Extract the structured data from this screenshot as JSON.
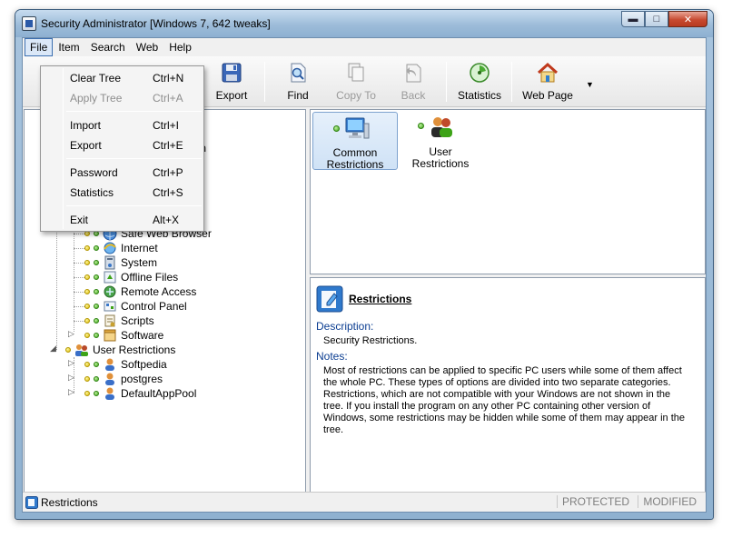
{
  "window": {
    "title": "Security Administrator [Windows 7, 642 tweaks]"
  },
  "caption": {
    "minimize": "▬",
    "maximize": "□",
    "close": "✕"
  },
  "menubar": {
    "file": "File",
    "item": "Item",
    "search": "Search",
    "web": "Web",
    "help": "Help"
  },
  "file_menu": {
    "clear_tree": {
      "label": "Clear Tree",
      "shortcut": "Ctrl+N"
    },
    "apply_tree": {
      "label": "Apply Tree",
      "shortcut": "Ctrl+A"
    },
    "import": {
      "label": "Import",
      "shortcut": "Ctrl+I"
    },
    "export": {
      "label": "Export",
      "shortcut": "Ctrl+E"
    },
    "password": {
      "label": "Password",
      "shortcut": "Ctrl+P"
    },
    "statistics": {
      "label": "Statistics",
      "shortcut": "Ctrl+S"
    },
    "exit": {
      "label": "Exit",
      "shortcut": "Alt+X"
    }
  },
  "toolbar": {
    "export": "Export",
    "find": "Find",
    "copy_to": "Copy To",
    "back": "Back",
    "statistics": "Statistics",
    "web_page": "Web Page",
    "dropdown_arrow": "▼"
  },
  "tree": {
    "partial_hidden_text": "own",
    "items": [
      {
        "label": "Safe Web Browser",
        "icon": "globe-icon"
      },
      {
        "label": "Internet",
        "icon": "ie-icon"
      },
      {
        "label": "System",
        "icon": "system-icon"
      },
      {
        "label": "Offline Files",
        "icon": "offline-files-icon"
      },
      {
        "label": "Remote Access",
        "icon": "remote-access-icon"
      },
      {
        "label": "Control Panel",
        "icon": "control-panel-icon"
      },
      {
        "label": "Scripts",
        "icon": "scripts-icon"
      },
      {
        "label": "Software",
        "icon": "software-icon"
      }
    ],
    "user_restrictions": "User Restrictions",
    "users": [
      {
        "label": "Softpedia"
      },
      {
        "label": "postgres"
      },
      {
        "label": "DefaultAppPool"
      }
    ]
  },
  "categories": {
    "common": "Common Restrictions",
    "common_line1": "Common",
    "common_line2": "Restrictions",
    "user_line1": "User",
    "user_line2": "Restrictions"
  },
  "detail": {
    "title": "Restrictions",
    "description_label": "Description:",
    "description": "Security Restrictions.",
    "notes_label": "Notes:",
    "notes": "Most of restrictions can be applied to specific PC users while some of them affect the whole PC. These types of options are divided into two separate categories. Restrictions, which are not compatible with your Windows are not shown in the tree. If you install the program on any other PC containing other version of Windows, some restrictions may be hidden while some of them may appear in the tree."
  },
  "status": {
    "text": "Restrictions",
    "protected": "PROTECTED",
    "modified": "MODIFIED"
  },
  "colors": {
    "menu_highlight": "#dbe8f8",
    "selection": "#cfe2f6",
    "label_blue": "#0b3d91",
    "close_red": "#c74a30"
  }
}
